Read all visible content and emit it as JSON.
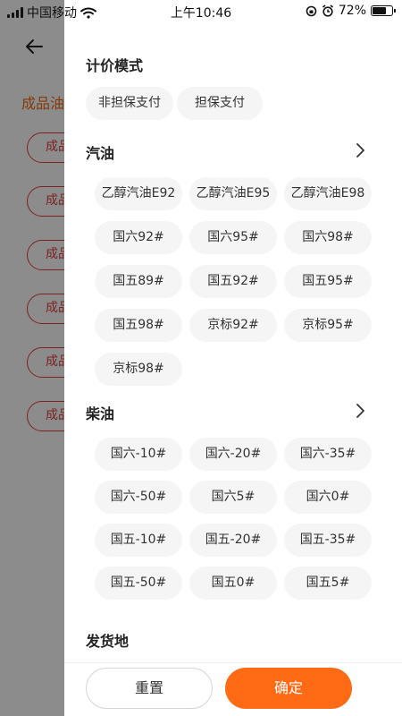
{
  "status_bar": {
    "carrier": "中国移动",
    "time": "上午10:46",
    "battery_percent": "72%",
    "battery_level": 0.72
  },
  "background_page": {
    "title": "成品油",
    "chip_label": "成品"
  },
  "drawer": {
    "pricing_mode": {
      "title": "计价模式",
      "options": [
        "非担保支付",
        "担保支付"
      ]
    },
    "gasoline": {
      "title": "汽油",
      "options": [
        "乙醇汽油E92",
        "乙醇汽油E95",
        "乙醇汽油E98",
        "国六92#",
        "国六95#",
        "国六98#",
        "国五89#",
        "国五92#",
        "国五95#",
        "国五98#",
        "京标92#",
        "京标95#",
        "京标98#"
      ]
    },
    "diesel": {
      "title": "柴油",
      "options": [
        "国六-10#",
        "国六-20#",
        "国六-35#",
        "国六-50#",
        "国六5#",
        "国六0#",
        "国五-10#",
        "国五-20#",
        "国五-35#",
        "国五-50#",
        "国五0#",
        "国五5#"
      ]
    },
    "origin": {
      "title": "发货地"
    }
  },
  "footer": {
    "reset_label": "重置",
    "confirm_label": "确定"
  },
  "colors": {
    "accent": "#ff6a14",
    "background_accent": "#f06a10",
    "background_chip_border": "#e24040",
    "chip_bg": "#f5f5f5"
  }
}
